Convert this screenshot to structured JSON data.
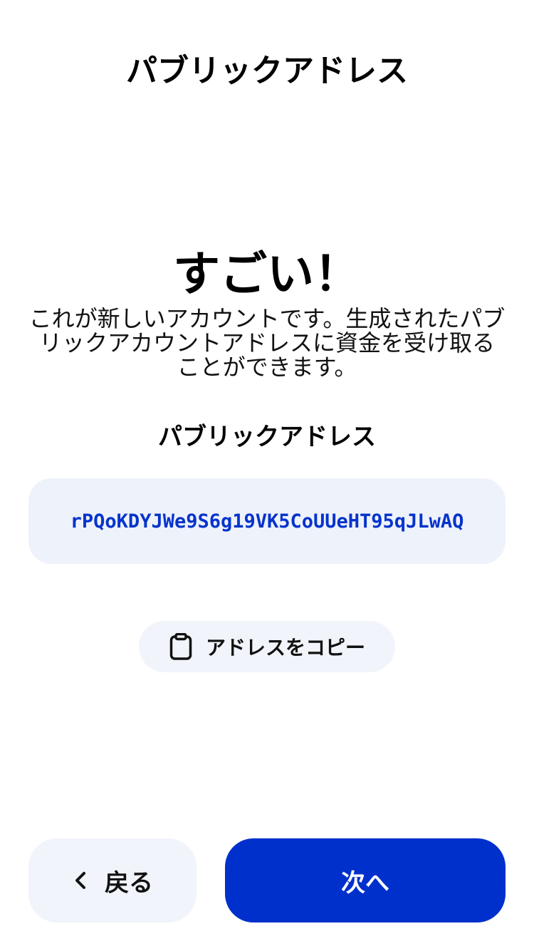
{
  "header": {
    "title": "パブリックアドレス"
  },
  "hero": {
    "title": "すごい！",
    "description": "これが新しいアカウントです。生成されたパブリックアカウントアドレスに資金を受け取ることができます。"
  },
  "address": {
    "label": "パブリックアドレス",
    "value": "rPQoKDYJWe9S6g19VK5CoUUeHT95qJLwAQ"
  },
  "copy_button": {
    "icon": "clipboard-icon",
    "label": "アドレスをコピー"
  },
  "footer": {
    "back_icon": "chevron-left-icon",
    "back_label": "戻る",
    "next_label": "次へ"
  },
  "colors": {
    "accent": "#0030cc",
    "address_text": "#0433cc",
    "surface": "#f1f4fa"
  }
}
